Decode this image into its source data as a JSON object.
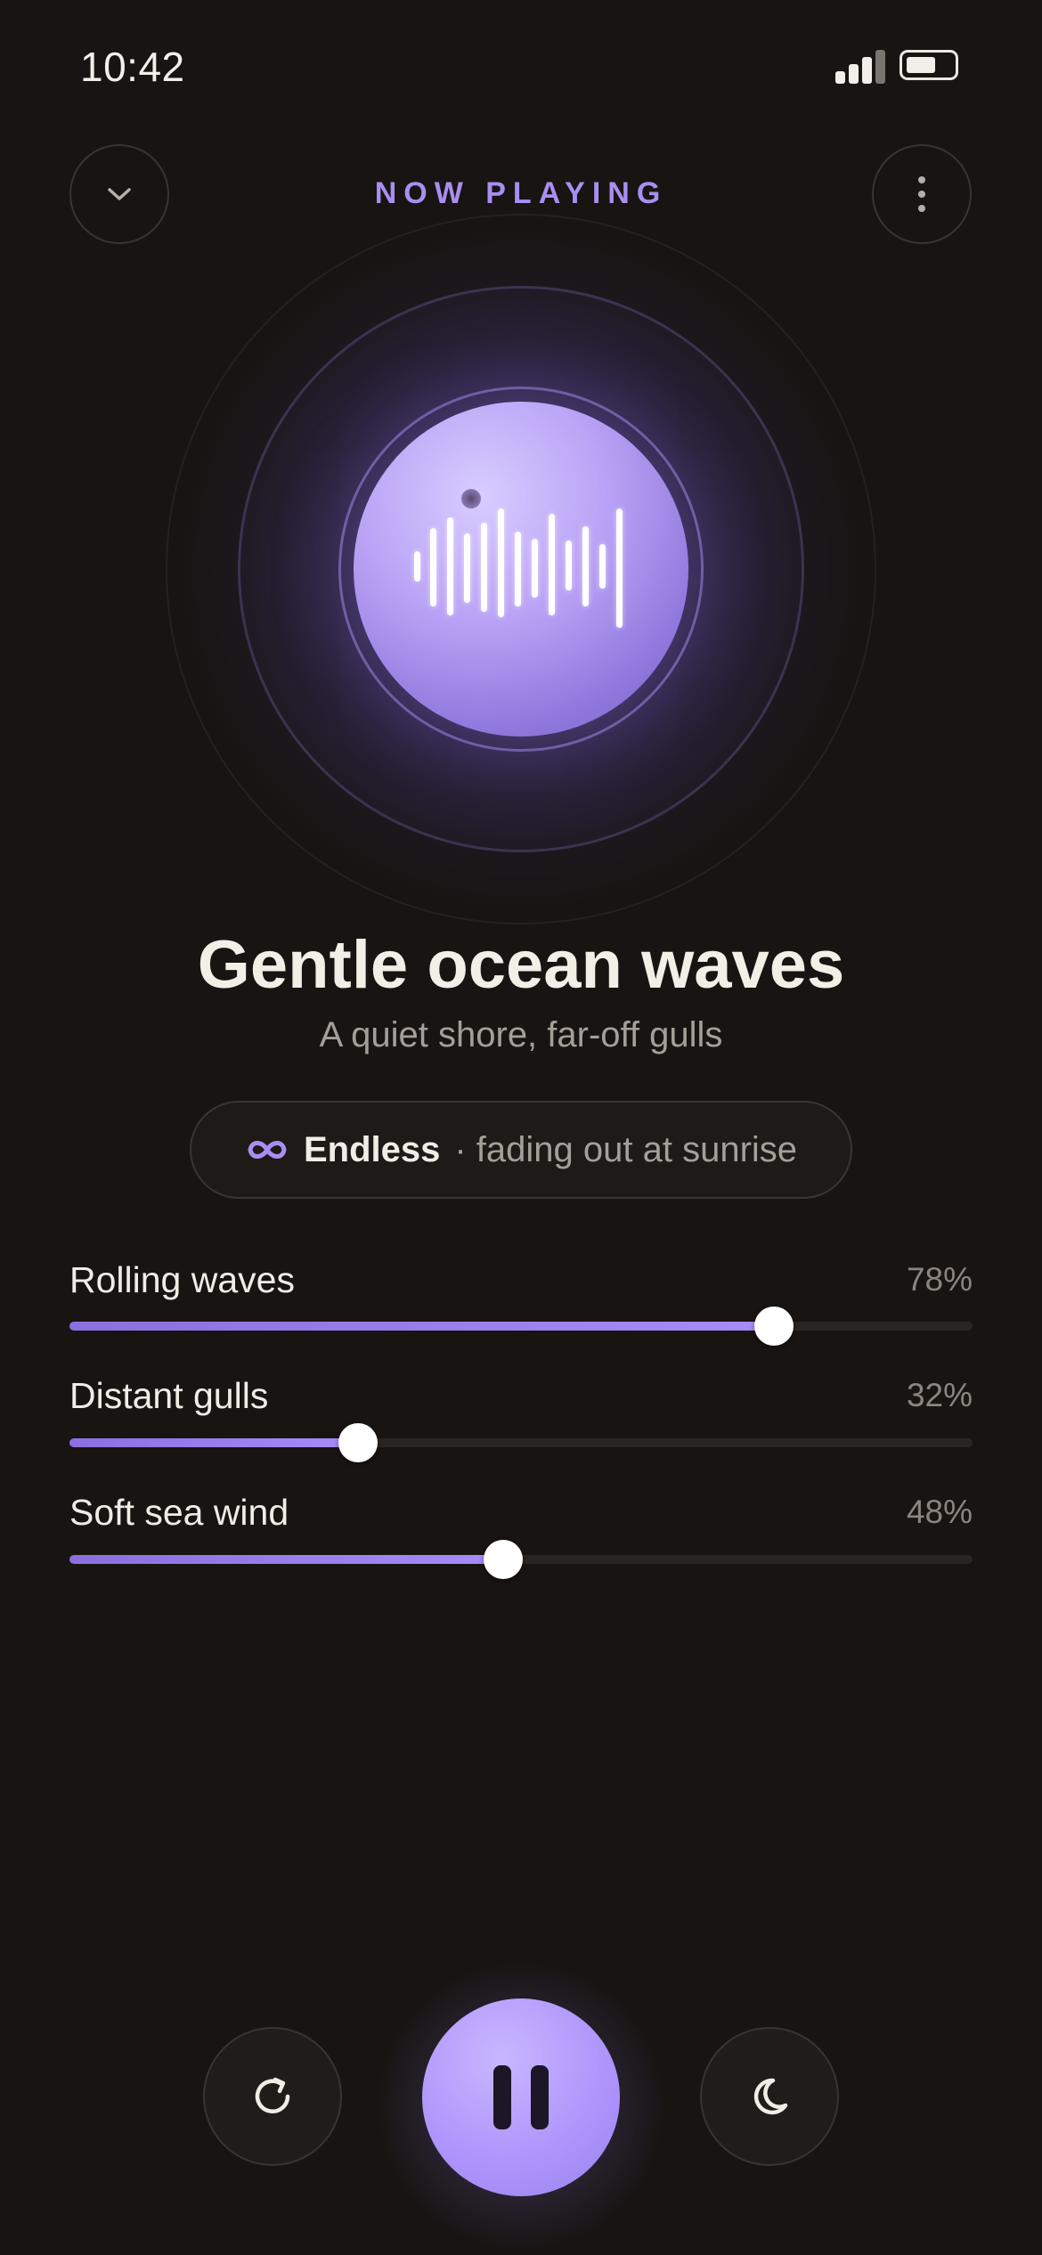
{
  "status_bar": {
    "time": "10:42"
  },
  "header": {
    "label": "NOW PLAYING"
  },
  "track": {
    "title": "Gentle ocean waves",
    "subtitle": "A quiet shore, far-off gulls"
  },
  "mode": {
    "label": "Endless",
    "detail": "· fading out at sunrise"
  },
  "mix": [
    {
      "label": "Rolling waves",
      "value_text": "78%",
      "value": 0.78
    },
    {
      "label": "Distant gulls",
      "value_text": "32%",
      "value": 0.32
    },
    {
      "label": "Soft sea wind",
      "value_text": "48%",
      "value": 0.48
    }
  ],
  "colors": {
    "background": "#181412",
    "accent": "#a98ef2",
    "play": "#ad93fb"
  },
  "icons": {
    "back": "chevron-down-icon",
    "more": "more-vertical-icon",
    "mode": "infinity-icon",
    "restart": "restart-icon",
    "play": "pause-icon",
    "sleep": "moon-icon"
  }
}
